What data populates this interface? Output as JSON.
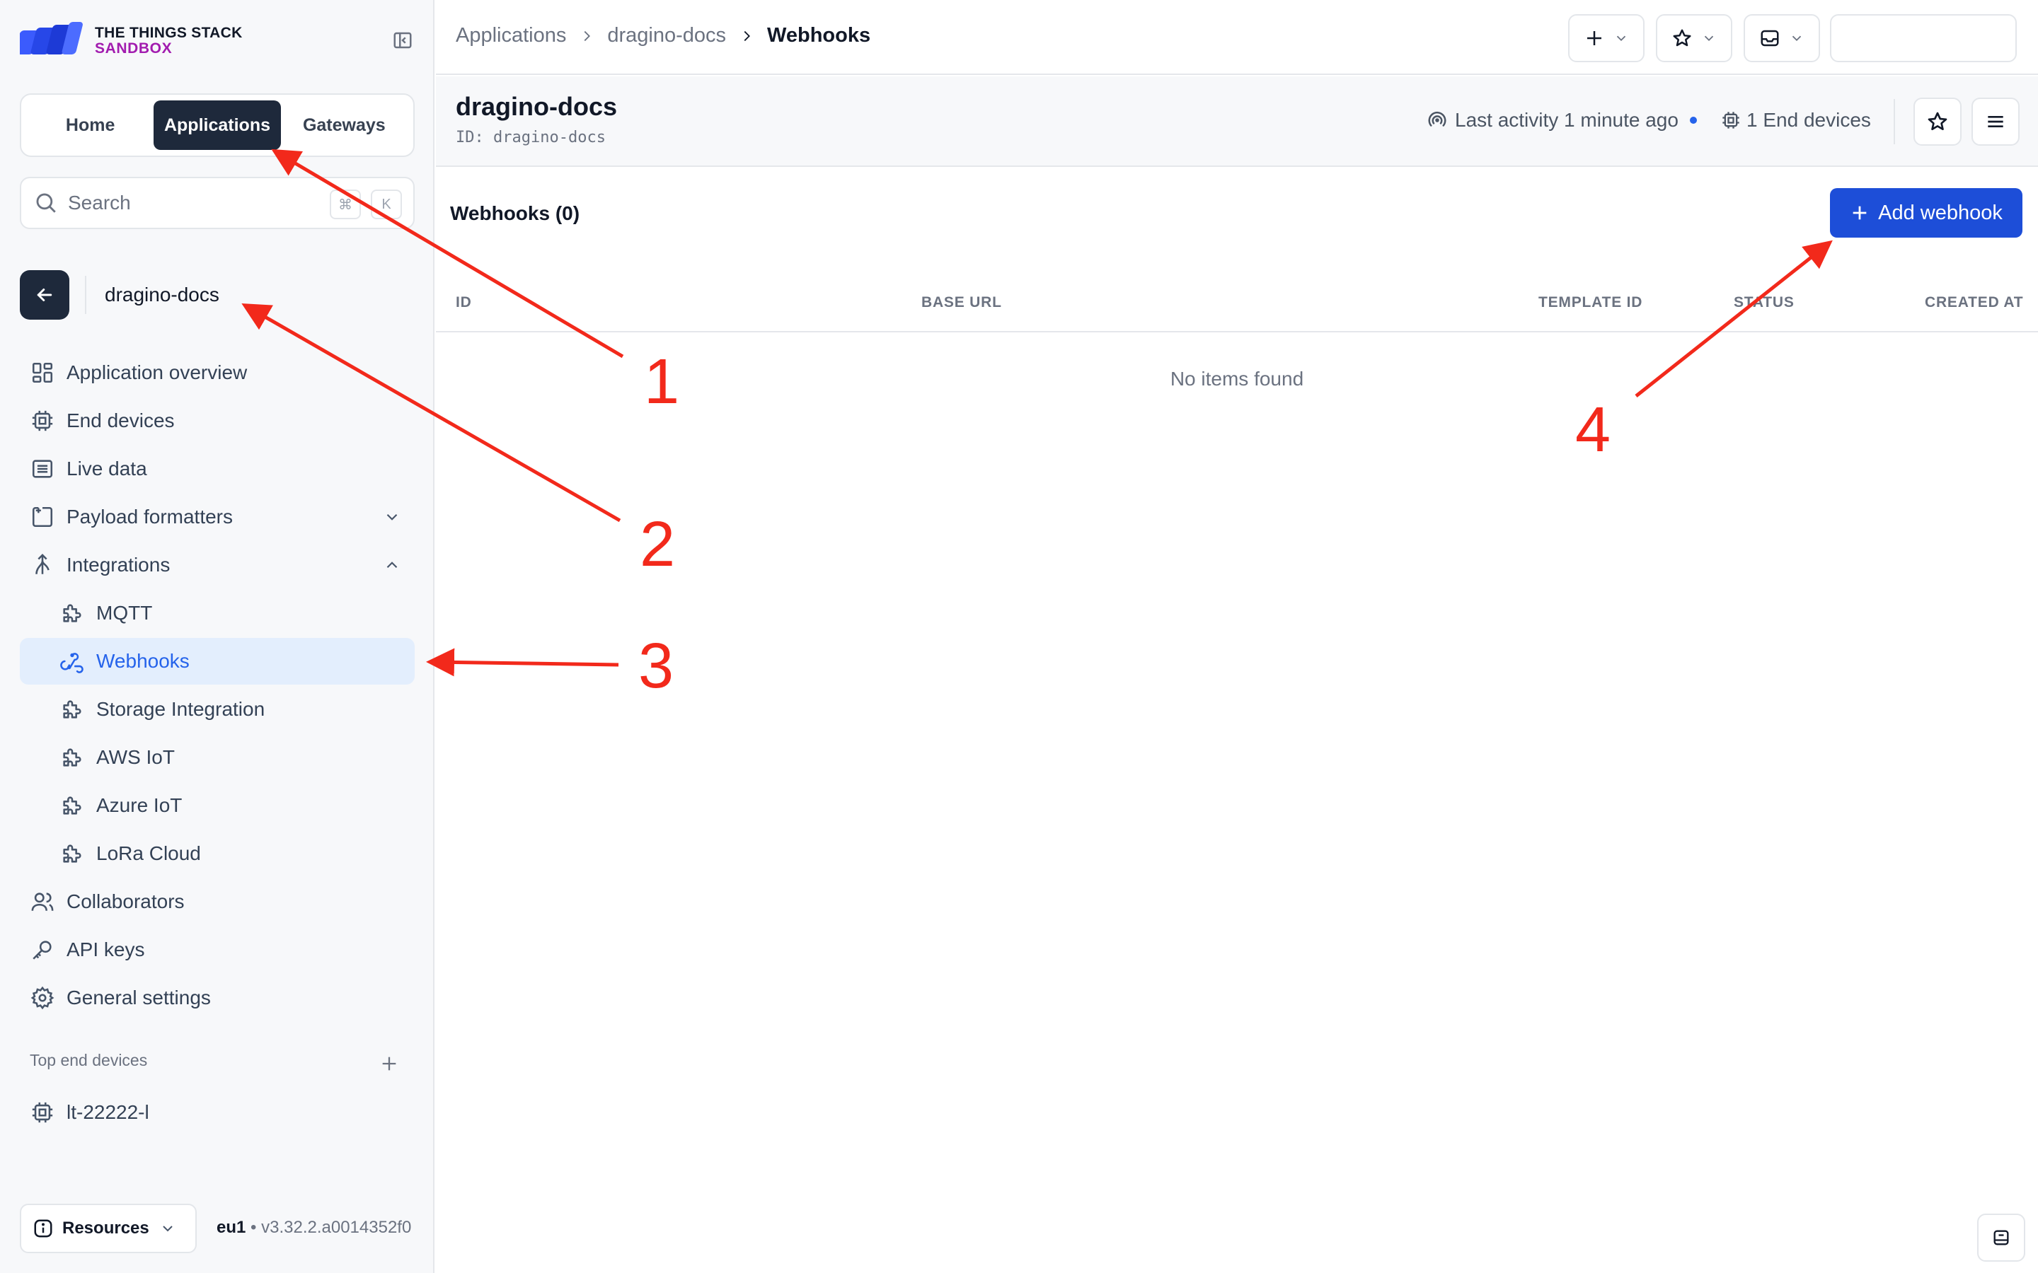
{
  "brand": {
    "line1": "THE THINGS STACK",
    "line2": "SANDBOX"
  },
  "nav_tabs": [
    {
      "label": "Home"
    },
    {
      "label": "Applications"
    },
    {
      "label": "Gateways"
    }
  ],
  "search": {
    "placeholder": "Search",
    "shortcut_mod": "⌘",
    "shortcut_key": "K"
  },
  "application": {
    "name": "dragino-docs",
    "id_label": "ID:",
    "id": "dragino-docs"
  },
  "sidebar_menu": [
    {
      "label": "Application overview",
      "icon": "grid-icon"
    },
    {
      "label": "End devices",
      "icon": "chip-icon"
    },
    {
      "label": "Live data",
      "icon": "list-icon"
    },
    {
      "label": "Payload formatters",
      "icon": "code-icon"
    },
    {
      "label": "Integrations",
      "icon": "integrations-icon"
    },
    {
      "label": "MQTT",
      "icon": "puzzle-icon"
    },
    {
      "label": "Webhooks",
      "icon": "webhook-icon"
    },
    {
      "label": "Storage Integration",
      "icon": "puzzle-icon"
    },
    {
      "label": "AWS IoT",
      "icon": "puzzle-icon"
    },
    {
      "label": "Azure IoT",
      "icon": "puzzle-icon"
    },
    {
      "label": "LoRa Cloud",
      "icon": "puzzle-icon"
    },
    {
      "label": "Collaborators",
      "icon": "users-icon"
    },
    {
      "label": "API keys",
      "icon": "key-icon"
    },
    {
      "label": "General settings",
      "icon": "gear-icon"
    }
  ],
  "top_end_devices": {
    "label": "Top end devices",
    "items": [
      {
        "label": "lt-22222-l"
      }
    ]
  },
  "footer": {
    "resources_label": "Resources",
    "cluster": "eu1",
    "separator": "•",
    "version": "v3.32.2.a0014352f0"
  },
  "breadcrumbs": [
    "Applications",
    "dragino-docs",
    "Webhooks"
  ],
  "header": {
    "last_activity": "Last activity 1 minute ago",
    "end_devices": "1 End devices"
  },
  "webhooks": {
    "title": "Webhooks (0)",
    "add_label": "Add webhook",
    "columns": [
      "ID",
      "BASE URL",
      "TEMPLATE ID",
      "STATUS",
      "CREATED AT"
    ],
    "empty_text": "No items found"
  },
  "annotations": [
    "1",
    "2",
    "3",
    "4"
  ],
  "colors": {
    "accent": "#1d4ed8",
    "sidebar_active_bg": "#e3eefd",
    "sidebar_active_text": "#2563eb",
    "dark": "#1e293b",
    "brand_magenta": "#a21caf",
    "annotation_red": "#f2291b"
  }
}
